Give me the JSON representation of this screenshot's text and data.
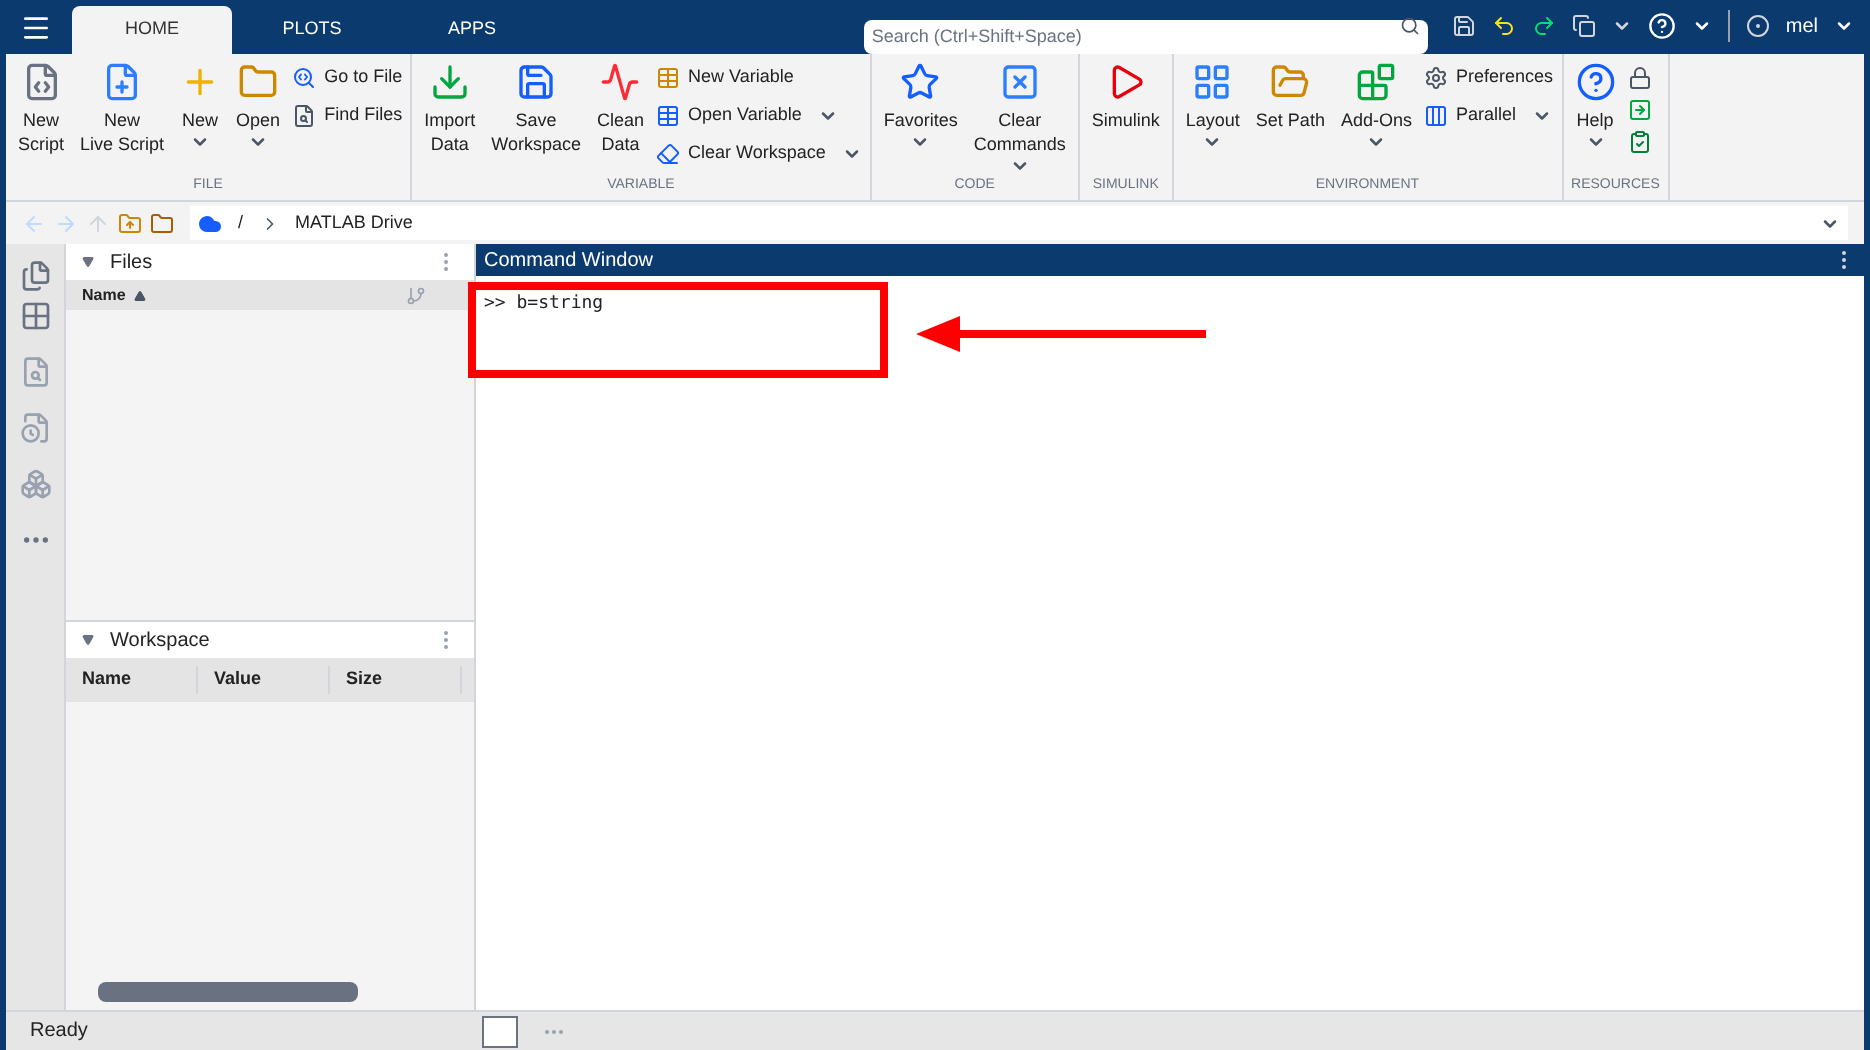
{
  "title_bar": {
    "tabs": [
      {
        "label": "HOME",
        "selected": true
      },
      {
        "label": "PLOTS",
        "selected": false
      },
      {
        "label": "APPS",
        "selected": false
      }
    ],
    "search": {
      "placeholder": "Search (Ctrl+Shift+Space)"
    },
    "user": "mel"
  },
  "ribbon": [
    {
      "label": "FILE",
      "columns": [
        {
          "kind": "large",
          "lines": [
            "New",
            "Script"
          ],
          "dropdown": false
        },
        {
          "kind": "large",
          "lines": [
            "New",
            "Live Script"
          ],
          "dropdown": false
        },
        {
          "kind": "large",
          "lines": [
            "New"
          ],
          "dropdown": true
        },
        {
          "kind": "large",
          "lines": [
            "Open"
          ],
          "dropdown": true
        },
        {
          "kind": "stack",
          "items": [
            {
              "label": "Go to File",
              "dropdown": false
            },
            {
              "label": "Find Files",
              "dropdown": false
            }
          ]
        }
      ]
    },
    {
      "label": "VARIABLE",
      "columns": [
        {
          "kind": "large",
          "lines": [
            "Import",
            "Data"
          ],
          "dropdown": false
        },
        {
          "kind": "large",
          "lines": [
            "Save",
            "Workspace"
          ],
          "dropdown": false
        },
        {
          "kind": "large",
          "lines": [
            "Clean",
            "Data"
          ],
          "dropdown": false
        },
        {
          "kind": "stack",
          "items": [
            {
              "label": "New Variable",
              "dropdown": false
            },
            {
              "label": "Open Variable",
              "dropdown": true
            },
            {
              "label": "Clear Workspace",
              "dropdown": true
            }
          ]
        }
      ]
    },
    {
      "label": "CODE",
      "columns": [
        {
          "kind": "large",
          "lines": [
            "Favorites"
          ],
          "dropdown": true
        },
        {
          "kind": "large",
          "lines": [
            "Clear",
            "Commands"
          ],
          "dropdown": true
        }
      ]
    },
    {
      "label": "SIMULINK",
      "columns": [
        {
          "kind": "large",
          "lines": [
            "Simulink"
          ],
          "dropdown": false
        }
      ]
    },
    {
      "label": "ENVIRONMENT",
      "columns": [
        {
          "kind": "large",
          "lines": [
            "Layout"
          ],
          "dropdown": true
        },
        {
          "kind": "large",
          "lines": [
            "Set Path"
          ],
          "dropdown": false
        },
        {
          "kind": "large",
          "lines": [
            "Add-Ons"
          ],
          "dropdown": true
        },
        {
          "kind": "stack",
          "items": [
            {
              "label": "Preferences",
              "dropdown": false
            },
            {
              "label": "Parallel",
              "dropdown": true
            }
          ]
        }
      ]
    },
    {
      "label": "RESOURCES",
      "columns": [
        {
          "kind": "large",
          "lines": [
            "Help"
          ],
          "dropdown": true
        },
        {
          "kind": "icons"
        }
      ]
    }
  ],
  "address_bar": {
    "separator": "/",
    "folder": "MATLAB Drive"
  },
  "files_panel": {
    "title": "Files",
    "columns": [
      "Name"
    ]
  },
  "workspace_panel": {
    "title": "Workspace",
    "columns": [
      "Name",
      "Value",
      "Size"
    ]
  },
  "command_window": {
    "title": "Command Window",
    "lines": [
      ">> b=string"
    ]
  },
  "status_bar": {
    "text": "Ready"
  }
}
